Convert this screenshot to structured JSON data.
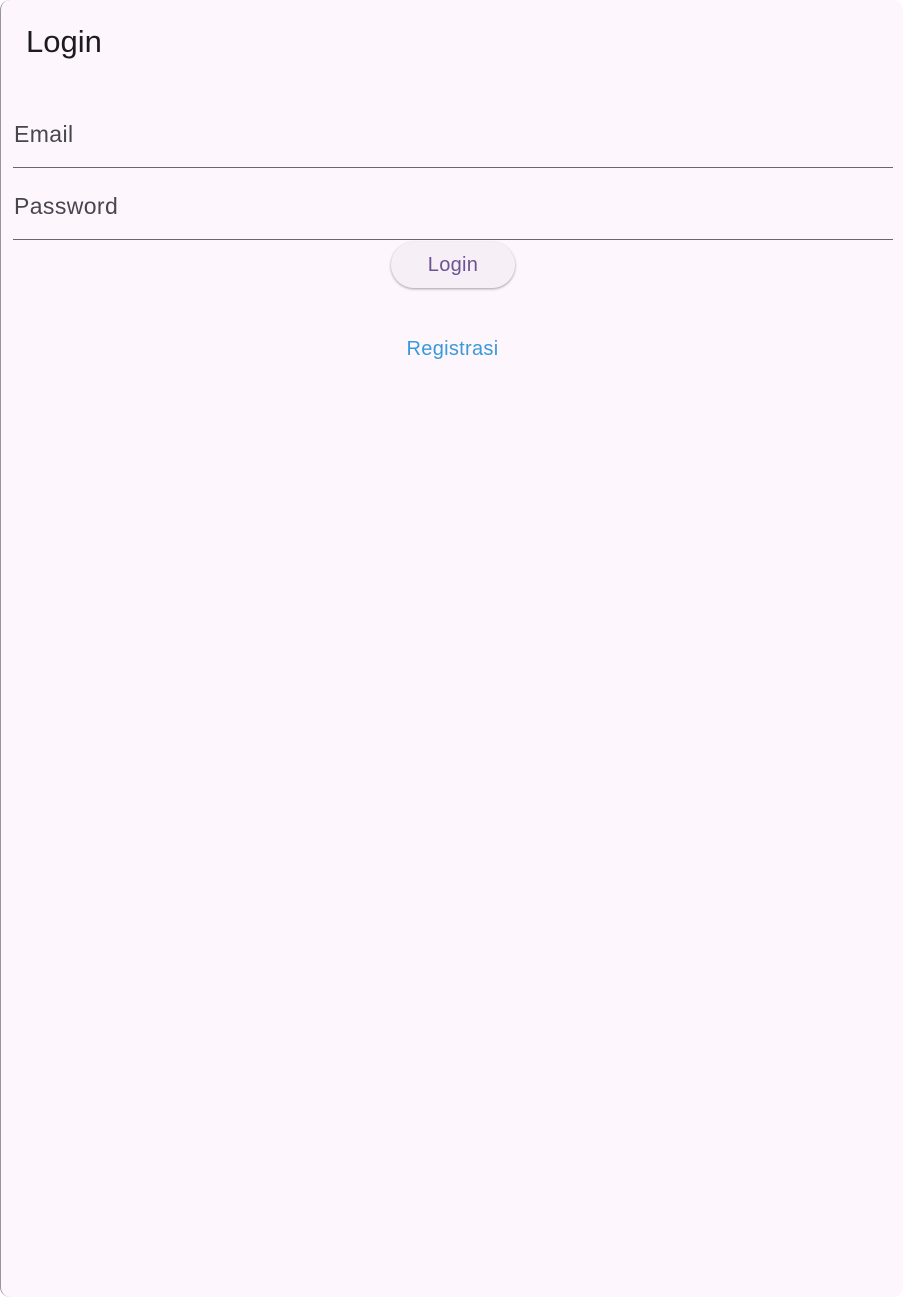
{
  "app_bar": {
    "title": "Login"
  },
  "form": {
    "email": {
      "value": "",
      "placeholder": "Email"
    },
    "password": {
      "value": "",
      "placeholder": "Password"
    },
    "login_button_label": "Login",
    "register_link_label": "Registrasi"
  },
  "colors": {
    "background": "#fdf6fd",
    "button_text": "#6a5496",
    "link": "#3a9ad9"
  }
}
